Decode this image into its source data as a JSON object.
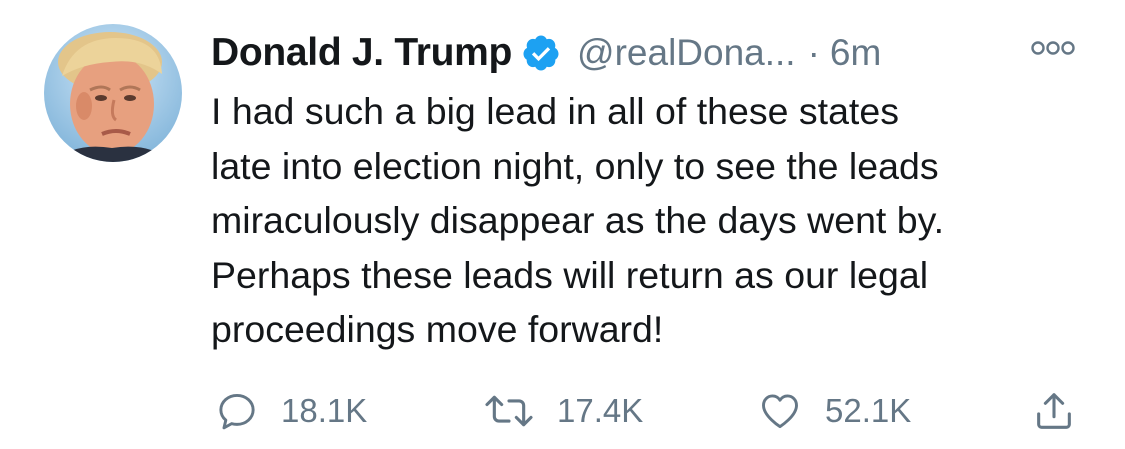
{
  "tweet": {
    "author": {
      "display_name": "Donald J. Trump",
      "handle": "@realDona...",
      "verified": true,
      "avatar_icon": "profile-photo"
    },
    "separator": "·",
    "time": "6m",
    "text_lines": [
      "I had such a big lead in all of these states",
      "late into election night, only to see the leads",
      "miraculously disappear as the days went by.",
      "Perhaps these leads will return as our legal",
      "proceedings move forward!"
    ],
    "metrics": {
      "replies": "18.1K",
      "retweets": "17.4K",
      "likes": "52.1K"
    }
  },
  "colors": {
    "text": "#14171a",
    "secondary": "#657786",
    "verified_blue": "#1da1f2"
  },
  "icons": {
    "verified": "verified-badge-icon",
    "more": "more-options-icon",
    "reply": "reply-icon",
    "retweet": "retweet-icon",
    "like": "heart-icon",
    "share": "share-icon"
  }
}
